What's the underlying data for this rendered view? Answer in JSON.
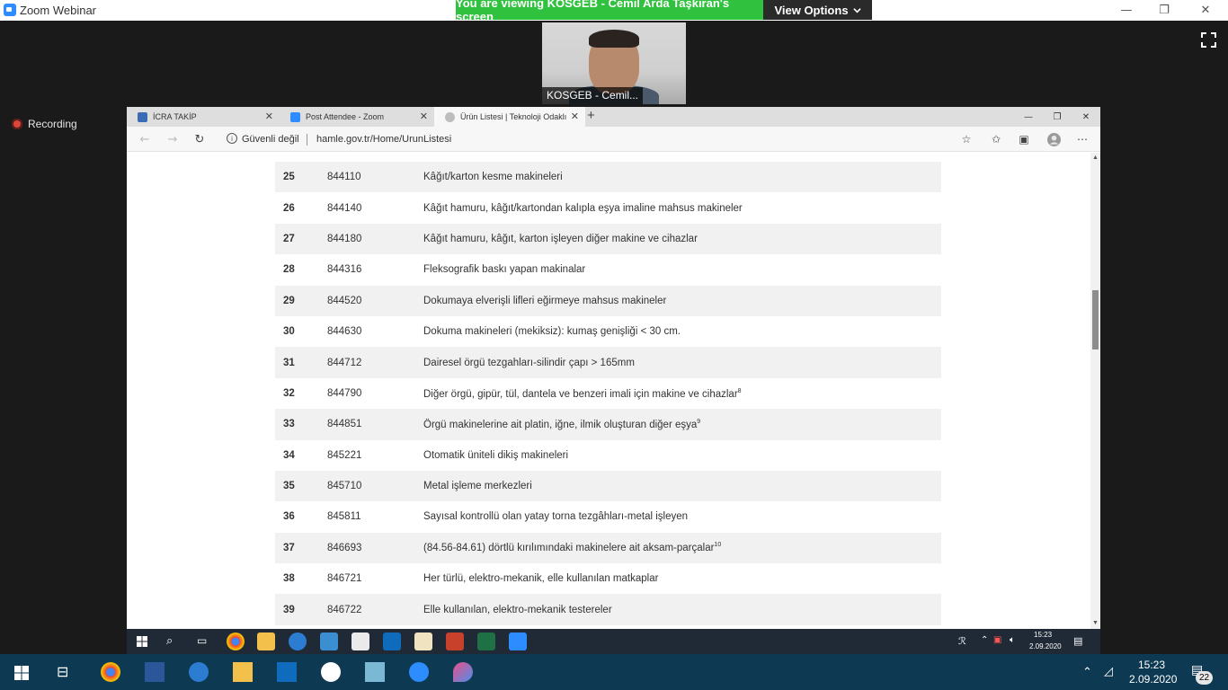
{
  "zoom": {
    "title": "Zoom Webinar",
    "banner": "You are viewing KOSGEB - Cemil Arda Taşkıran's screen",
    "view_options": "View Options",
    "video_label": "KOSGEB - Cemil...",
    "recording": "Recording",
    "minimize": "—",
    "maximize": "❐",
    "close": "✕"
  },
  "browser": {
    "tabs": [
      {
        "label": "İCRA TAKİP",
        "color": "#3a6bb5"
      },
      {
        "label": "Post Attendee - Zoom",
        "color": "#2D8CFF"
      },
      {
        "label": "Ürün Listesi | Teknoloji Odaklı Sa",
        "color": "#bdbdbd"
      }
    ],
    "security": "Güvenli değil",
    "url": "hamle.gov.tr/Home/UrunListesi"
  },
  "table": {
    "rows": [
      {
        "no": "25",
        "code": "844110",
        "desc": "Kâğıt/karton kesme makineleri",
        "sup": ""
      },
      {
        "no": "26",
        "code": "844140",
        "desc": "Kâğıt hamuru, kâğıt/kartondan kalıpla eşya imaline mahsus makineler",
        "sup": ""
      },
      {
        "no": "27",
        "code": "844180",
        "desc": "Kâğıt hamuru, kâğıt, karton işleyen diğer makine ve cihazlar",
        "sup": ""
      },
      {
        "no": "28",
        "code": "844316",
        "desc": "Fleksografik baskı yapan makinalar",
        "sup": ""
      },
      {
        "no": "29",
        "code": "844520",
        "desc": "Dokumaya elverişli lifleri eğirmeye mahsus makineler",
        "sup": ""
      },
      {
        "no": "30",
        "code": "844630",
        "desc": "Dokuma makineleri (mekiksiz): kumaş genişliği < 30 cm.",
        "sup": ""
      },
      {
        "no": "31",
        "code": "844712",
        "desc": "Dairesel örgü tezgahları-silindir çapı > 165mm",
        "sup": ""
      },
      {
        "no": "32",
        "code": "844790",
        "desc": "Diğer örgü, gipür, tül, dantela ve benzeri imali için makine ve cihazlar",
        "sup": "8"
      },
      {
        "no": "33",
        "code": "844851",
        "desc": "Örgü makinelerine ait platin, iğne, ilmik oluşturan diğer eşya",
        "sup": "9"
      },
      {
        "no": "34",
        "code": "845221",
        "desc": "Otomatik üniteli dikiş makineleri",
        "sup": ""
      },
      {
        "no": "35",
        "code": "845710",
        "desc": "Metal işleme merkezleri",
        "sup": ""
      },
      {
        "no": "36",
        "code": "845811",
        "desc": "Sayısal kontrollü olan yatay torna tezgâhları-metal işleyen",
        "sup": ""
      },
      {
        "no": "37",
        "code": "846693",
        "desc": "(84.56-84.61) dörtlü kırılımındaki makinelere ait aksam-parçalar",
        "sup": "10"
      },
      {
        "no": "38",
        "code": "846721",
        "desc": "Her türlü, elektro-mekanik, elle kullanılan matkaplar",
        "sup": ""
      },
      {
        "no": "39",
        "code": "846722",
        "desc": "Elle kullanılan, elektro-mekanik testereler",
        "sup": ""
      }
    ]
  },
  "inner_taskbar": {
    "time": "15:23",
    "date": "2.09.2020"
  },
  "outer_taskbar": {
    "time": "15:23",
    "date": "2.09.2020",
    "notifications": "22"
  },
  "colors": {
    "banner": "#30c13f",
    "taskbar": "#0d3a52",
    "zoom_blue": "#2D8CFF"
  }
}
